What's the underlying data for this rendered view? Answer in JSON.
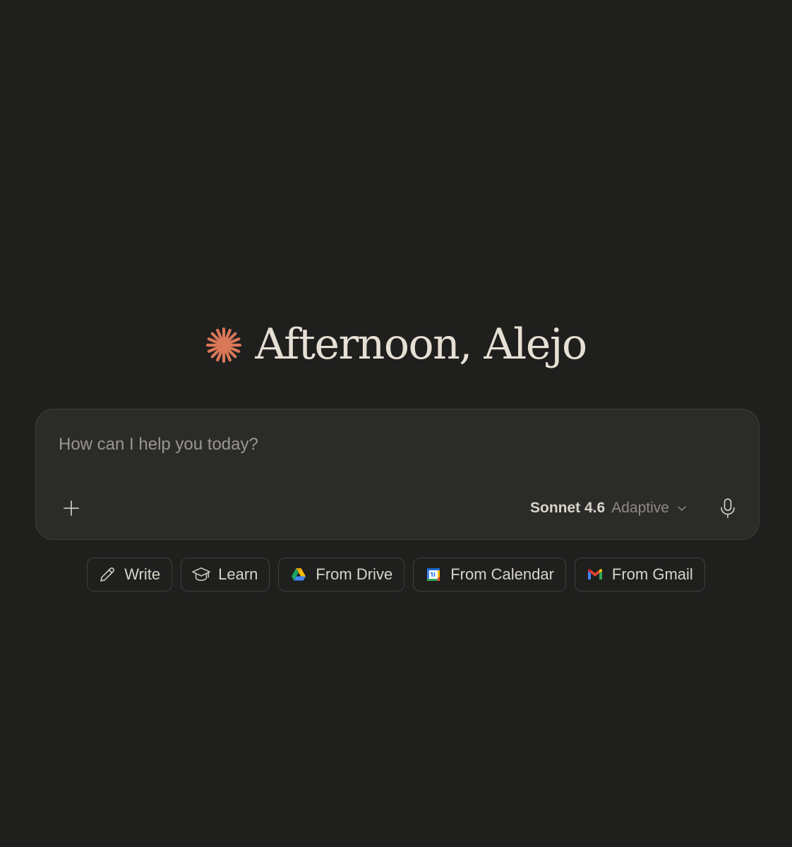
{
  "greeting": {
    "text": "Afternoon, Alejo",
    "logo_icon": "sparkle-asterisk-icon",
    "logo_color": "#d97757"
  },
  "composer": {
    "placeholder": "How can I help you today?",
    "value": "",
    "add_icon": "plus-icon",
    "model": {
      "name": "Sonnet 4.6",
      "mode": "Adaptive",
      "icon": "chevron-down-icon"
    },
    "mic_icon": "microphone-icon"
  },
  "chips": [
    {
      "label": "Write",
      "icon": "pencil-icon"
    },
    {
      "label": "Learn",
      "icon": "graduation-cap-icon"
    },
    {
      "label": "From Drive",
      "icon": "google-drive-icon"
    },
    {
      "label": "From Calendar",
      "icon": "google-calendar-icon"
    },
    {
      "label": "From Gmail",
      "icon": "gmail-icon"
    }
  ],
  "colors": {
    "background": "#1f1f1e",
    "composer_bg": "#2b2b29",
    "text_primary": "#e6e0d4",
    "text_muted": "#9b978e",
    "accent": "#d97757"
  }
}
